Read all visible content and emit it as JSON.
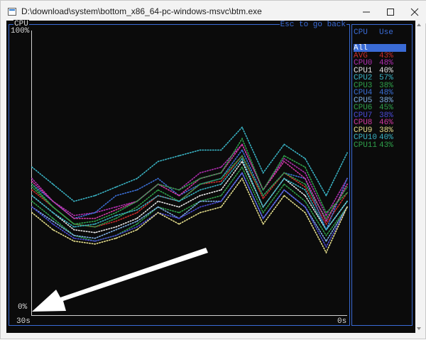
{
  "window": {
    "title": "D:\\download\\system\\bottom_x86_64-pc-windows-msvc\\btm.exe"
  },
  "cpu_widget": {
    "title": "CPU",
    "hint": "Esc to go back",
    "y_top_label": "100%",
    "y_bottom_label": "0%",
    "x_left_label": "30s",
    "x_right_label": "0s"
  },
  "legend": {
    "header_cpu": "CPU",
    "header_use": "Use",
    "rows": [
      {
        "name": "All",
        "use": "",
        "color": "#ffffff",
        "selected": true
      },
      {
        "name": "AVG",
        "use": "43%",
        "color": "#c82d2d"
      },
      {
        "name": "CPU0",
        "use": "48%",
        "color": "#b02fb0"
      },
      {
        "name": "CPU1",
        "use": "40%",
        "color": "#e6e6e6"
      },
      {
        "name": "CPU2",
        "use": "57%",
        "color": "#39b3c4"
      },
      {
        "name": "CPU3",
        "use": "38%",
        "color": "#2fa14b"
      },
      {
        "name": "CPU4",
        "use": "48%",
        "color": "#3b6fd4"
      },
      {
        "name": "CPU5",
        "use": "38%",
        "color": "#7fb0e6"
      },
      {
        "name": "CPU6",
        "use": "45%",
        "color": "#2fa14b"
      },
      {
        "name": "CPU7",
        "use": "38%",
        "color": "#4b4bd6"
      },
      {
        "name": "CPU8",
        "use": "46%",
        "color": "#d13aa3"
      },
      {
        "name": "CPU9",
        "use": "38%",
        "color": "#e6df8c"
      },
      {
        "name": "CPU10",
        "use": "40%",
        "color": "#39b3c4"
      },
      {
        "name": "CPU11",
        "use": "43%",
        "color": "#2fa14b"
      }
    ]
  },
  "chart_data": {
    "type": "line",
    "title": "CPU",
    "x_range": [
      30,
      0
    ],
    "y_range": [
      0,
      100
    ],
    "x_tick_labels": [
      "30s",
      "0s"
    ],
    "y_tick_labels": [
      "100%",
      "0%"
    ],
    "x": [
      30,
      28,
      26,
      24,
      22,
      20,
      18,
      16,
      14,
      12,
      10,
      8,
      6,
      4,
      2,
      0
    ],
    "series": [
      {
        "name": "AVG",
        "color": "#c82d2d",
        "values": [
          44,
          38,
          32,
          31,
          33,
          36,
          42,
          40,
          46,
          47,
          56,
          41,
          50,
          45,
          32,
          43
        ]
      },
      {
        "name": "CPU0",
        "color": "#b02fb0",
        "values": [
          48,
          40,
          35,
          36,
          38,
          40,
          46,
          44,
          50,
          52,
          60,
          44,
          55,
          50,
          35,
          48
        ]
      },
      {
        "name": "CPU1",
        "color": "#e6e6e6",
        "values": [
          42,
          36,
          30,
          29,
          31,
          34,
          40,
          38,
          42,
          44,
          54,
          38,
          48,
          42,
          30,
          40
        ]
      },
      {
        "name": "CPU2",
        "color": "#39b3c4",
        "values": [
          52,
          46,
          40,
          42,
          45,
          48,
          54,
          56,
          58,
          58,
          66,
          50,
          60,
          55,
          42,
          57
        ]
      },
      {
        "name": "CPU3",
        "color": "#2fa14b",
        "values": [
          40,
          34,
          28,
          26,
          28,
          32,
          38,
          36,
          40,
          42,
          52,
          36,
          46,
          40,
          28,
          38
        ]
      },
      {
        "name": "CPU4",
        "color": "#3b6fd4",
        "values": [
          46,
          40,
          34,
          36,
          42,
          44,
          48,
          42,
          46,
          48,
          58,
          42,
          50,
          48,
          30,
          48
        ]
      },
      {
        "name": "CPU5",
        "color": "#7fb0e6",
        "values": [
          38,
          33,
          28,
          27,
          30,
          33,
          38,
          34,
          40,
          40,
          50,
          34,
          44,
          38,
          26,
          38
        ]
      },
      {
        "name": "CPU6",
        "color": "#2fa14b",
        "values": [
          46,
          38,
          32,
          31,
          34,
          38,
          44,
          40,
          46,
          48,
          56,
          42,
          50,
          46,
          34,
          45
        ]
      },
      {
        "name": "CPU7",
        "color": "#4b4bd6",
        "values": [
          38,
          32,
          27,
          26,
          28,
          31,
          36,
          34,
          38,
          40,
          50,
          34,
          44,
          38,
          24,
          38
        ]
      },
      {
        "name": "CPU8",
        "color": "#d13aa3",
        "values": [
          47,
          40,
          34,
          34,
          37,
          40,
          46,
          42,
          48,
          50,
          60,
          44,
          54,
          48,
          33,
          46
        ]
      },
      {
        "name": "CPU9",
        "color": "#e6df8c",
        "values": [
          36,
          30,
          26,
          25,
          27,
          30,
          36,
          32,
          36,
          38,
          48,
          32,
          42,
          36,
          22,
          38
        ]
      },
      {
        "name": "CPU10",
        "color": "#39b3c4",
        "values": [
          42,
          36,
          31,
          32,
          35,
          37,
          42,
          40,
          44,
          46,
          55,
          38,
          48,
          44,
          30,
          40
        ]
      },
      {
        "name": "CPU11",
        "color": "#2fa14b",
        "values": [
          45,
          38,
          32,
          33,
          36,
          40,
          46,
          44,
          48,
          50,
          62,
          44,
          56,
          52,
          36,
          43
        ]
      }
    ]
  }
}
